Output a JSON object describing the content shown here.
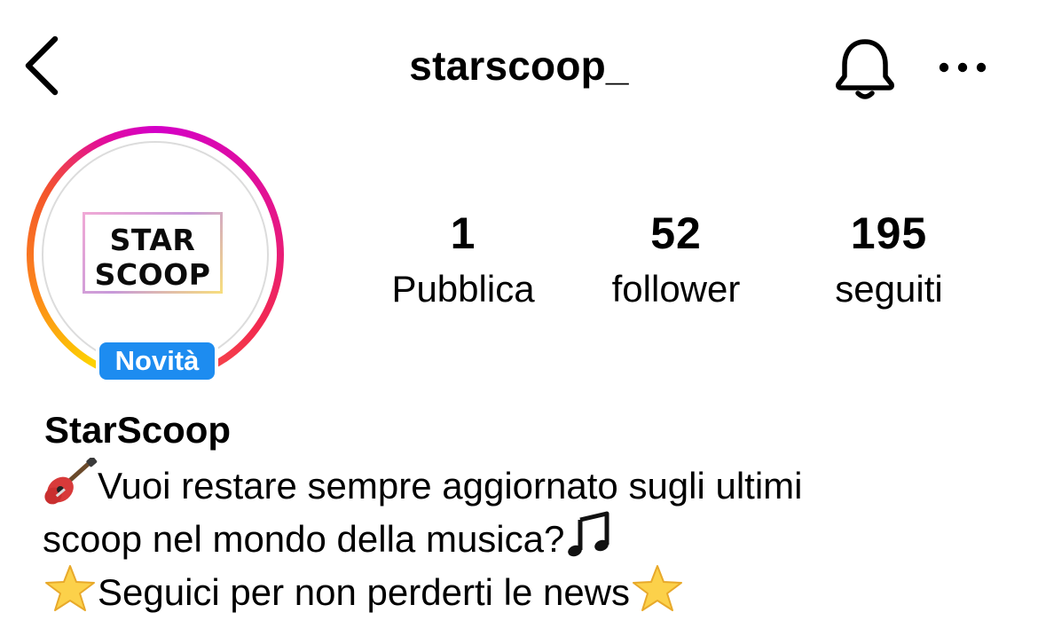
{
  "header": {
    "username": "starscoop_",
    "back_icon": "chevron-left-icon",
    "bell_icon": "bell-icon",
    "more_icon": "ellipsis-icon"
  },
  "avatar": {
    "logo_line_1": "STAR",
    "logo_line_2": "SCOOP",
    "badge": "Novità",
    "badge_color": "#1d8cf0",
    "ring_colors": [
      "#d400c8",
      "#e4158c",
      "#f22a4f",
      "#fdd200",
      "#fc8a1a"
    ]
  },
  "stats": [
    {
      "value": "1",
      "label": "Pubblica"
    },
    {
      "value": "52",
      "label": "follower"
    },
    {
      "value": "195",
      "label": "seguiti"
    }
  ],
  "bio": {
    "name": "StarScoop",
    "line1_text": "Vuoi restare sempre aggiornato sugli ultimi",
    "line2_text": "scoop nel mondo della musica?",
    "line3_text": "Seguici per non perderti le news",
    "emojis": [
      "guitar-emoji",
      "music-notes-emoji",
      "star-emoji"
    ]
  }
}
